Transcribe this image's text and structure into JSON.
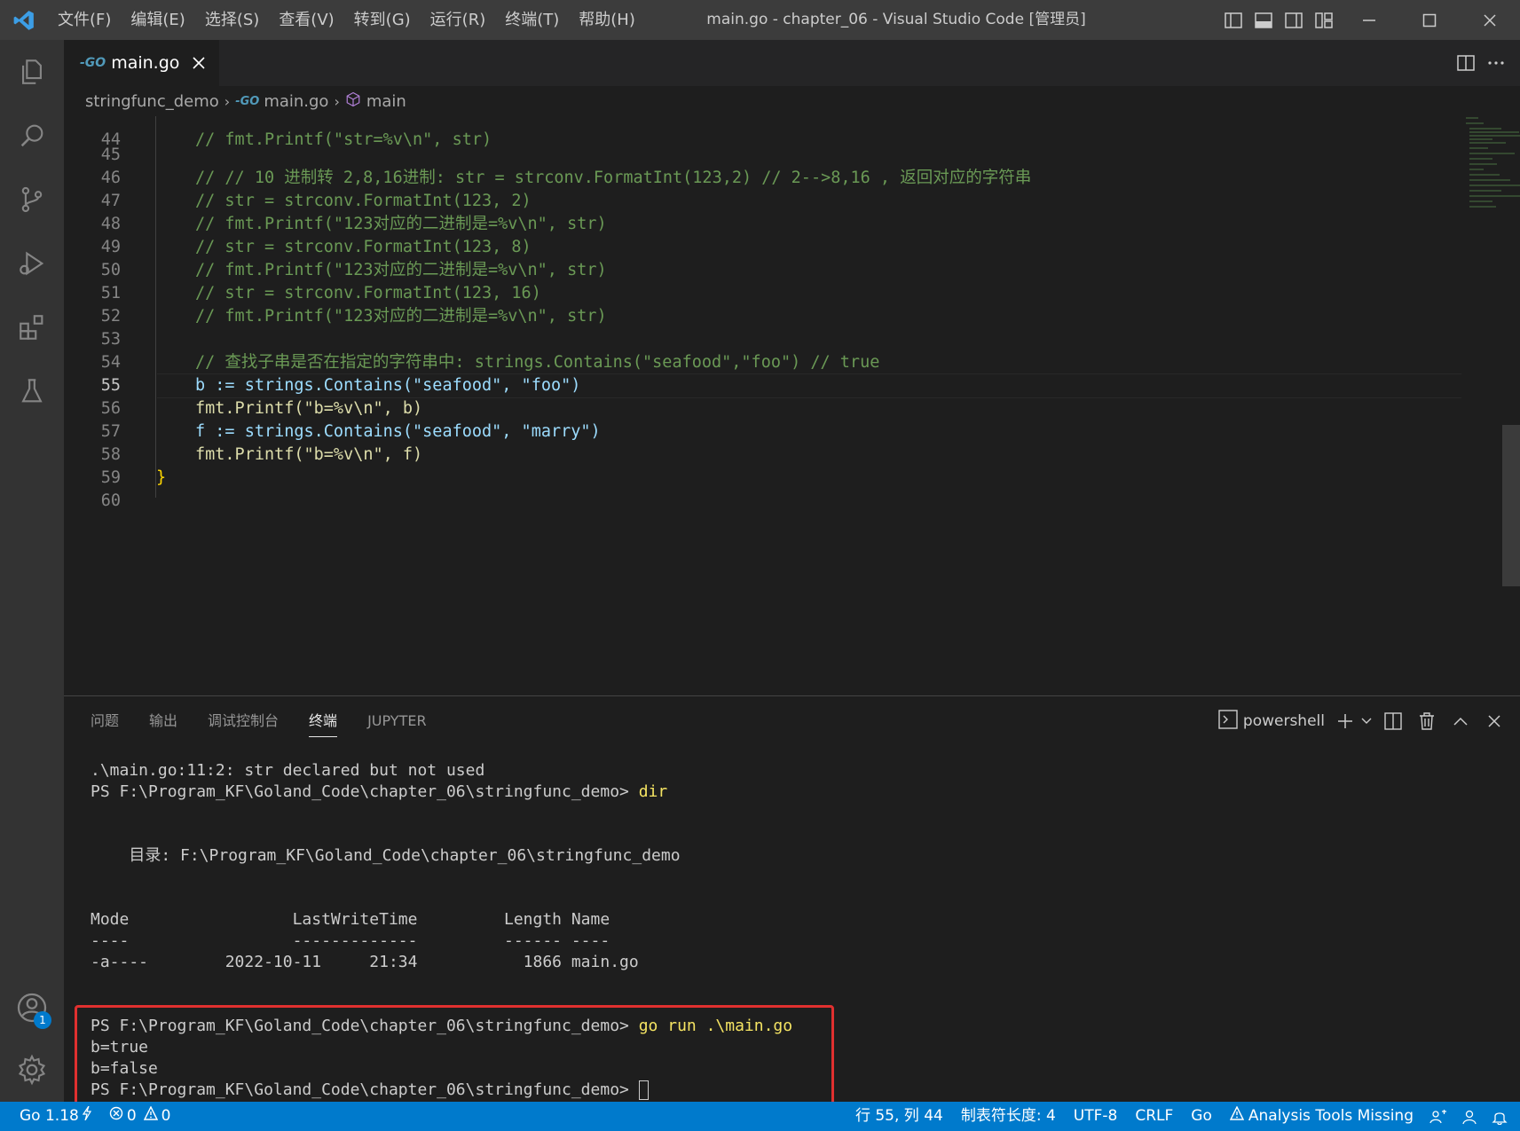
{
  "app": {
    "window_title": "main.go - chapter_06 - Visual Studio Code [管理员]",
    "menu": [
      "文件(F)",
      "编辑(E)",
      "选择(S)",
      "查看(V)",
      "转到(G)",
      "运行(R)",
      "终端(T)",
      "帮助(H)"
    ]
  },
  "tabs": [
    {
      "label": "main.go",
      "icon": "go-file-icon"
    }
  ],
  "breadcrumb": {
    "folder": "stringfunc_demo",
    "file": "main.go",
    "symbol": "main"
  },
  "code": {
    "lines": [
      {
        "n": "44",
        "text": "// fmt.Printf(\"str=%v\\n\", str)"
      },
      {
        "n": "45",
        "text": ""
      },
      {
        "n": "46",
        "text": "// // 10 进制转 2,8,16进制: str = strconv.FormatInt(123,2) // 2-->8,16 , 返回对应的字符串"
      },
      {
        "n": "47",
        "text": "// str = strconv.FormatInt(123, 2)"
      },
      {
        "n": "48",
        "text": "// fmt.Printf(\"123对应的二进制是=%v\\n\", str)"
      },
      {
        "n": "49",
        "text": "// str = strconv.FormatInt(123, 8)"
      },
      {
        "n": "50",
        "text": "// fmt.Printf(\"123对应的二进制是=%v\\n\", str)"
      },
      {
        "n": "51",
        "text": "// str = strconv.FormatInt(123, 16)"
      },
      {
        "n": "52",
        "text": "// fmt.Printf(\"123对应的二进制是=%v\\n\", str)"
      },
      {
        "n": "53",
        "text": ""
      },
      {
        "n": "54",
        "text": "// 查找子串是否在指定的字符串中: strings.Contains(\"seafood\",\"foo\") // true"
      },
      {
        "n": "55",
        "text": "b := strings.Contains(\"seafood\", \"foo\")"
      },
      {
        "n": "56",
        "text": "fmt.Printf(\"b=%v\\n\", b)"
      },
      {
        "n": "57",
        "text": "f := strings.Contains(\"seafood\", \"marry\")"
      },
      {
        "n": "58",
        "text": "fmt.Printf(\"b=%v\\n\", f)"
      },
      {
        "n": "59",
        "text": "}"
      },
      {
        "n": "60",
        "text": ""
      }
    ],
    "active_line": "55"
  },
  "panel": {
    "tabs": [
      "问题",
      "输出",
      "调试控制台",
      "终端",
      "JUPYTER"
    ],
    "active_tab": "终端",
    "terminal_name": "powershell"
  },
  "terminal": {
    "line1": ".\\main.go:11:2: str declared but not used",
    "prompt": "PS F:\\Program_KF\\Goland_Code\\chapter_06\\stringfunc_demo>",
    "cmd_dir": "dir",
    "dir_header": "    目录: F:\\Program_KF\\Goland_Code\\chapter_06\\stringfunc_demo",
    "table_header": "Mode                 LastWriteTime         Length Name",
    "table_sep": "----                 -------------         ------ ----",
    "table_row": "-a----        2022-10-11     21:34           1866 main.go",
    "cmd_run": "go run .\\main.go",
    "out1": "b=true",
    "out2": "b=false"
  },
  "statusbar": {
    "go_version": "Go 1.18",
    "errors": "0",
    "warnings": "0",
    "position": "行 55, 列 44",
    "tab_size": "制表符长度: 4",
    "encoding": "UTF-8",
    "eol": "CRLF",
    "language": "Go",
    "analysis": "Analysis Tools Missing"
  },
  "accounts_badge": "1",
  "colors": {
    "accent": "#007acc",
    "highlight_border": "#e0302f"
  }
}
